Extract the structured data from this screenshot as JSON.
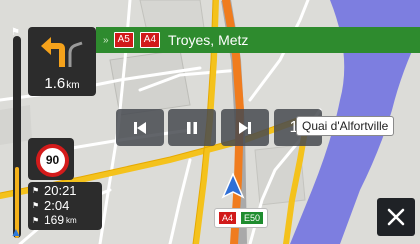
{
  "navigation": {
    "next_turn": {
      "icon": "turn-left-arrow-icon",
      "distance_value": "1.6",
      "distance_unit": "km"
    },
    "route_banner": {
      "icon": "double-chevron-icon",
      "road_shields": [
        "A5",
        "A4"
      ],
      "destination": "Troyes, Metz"
    },
    "speed_limit": "90",
    "trip_info": {
      "arrival_time": "20:21",
      "remaining_time": "2:04",
      "remaining_distance_value": "169",
      "remaining_distance_unit": "km"
    },
    "route_progress_fraction": 0.35
  },
  "playback_controls": {
    "prev_icon": "skip-previous-icon",
    "pause_icon": "pause-icon",
    "next_icon": "skip-next-icon",
    "speed_label": "1x"
  },
  "map": {
    "street_label": "Quai d'Alfortville",
    "current_road_shields": [
      {
        "label": "A4",
        "color": "#d11a1a"
      },
      {
        "label": "E50",
        "color": "#1e8c2e"
      }
    ]
  },
  "colors": {
    "route": "#f07c1e",
    "banner_green": "#2e8b2e",
    "river": "#7d7ee0",
    "major_road": "#f4c21c",
    "panel_dark": "#2c2c2c"
  },
  "close_icon": "close-x-icon"
}
